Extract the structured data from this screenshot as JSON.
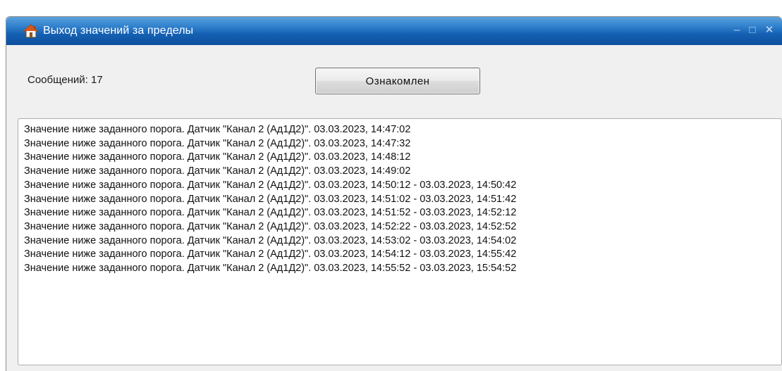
{
  "window": {
    "title": "Выход значений за пределы",
    "icon": "home-icon",
    "controls": {
      "minimize": "–",
      "maximize": "□",
      "close": "✕"
    },
    "colors": {
      "titlebar": "#1561b4",
      "background": "#f0f0f0"
    }
  },
  "header": {
    "count_label": "Сообщений: 17",
    "ack_button_label": "Ознакомлен"
  },
  "messages": [
    "Значение ниже заданного порога. Датчик \"Канал 2 (Ад1Д2)\". 03.03.2023, 14:47:02",
    "Значение ниже заданного порога. Датчик \"Канал 2 (Ад1Д2)\". 03.03.2023, 14:47:32",
    "Значение ниже заданного порога. Датчик \"Канал 2 (Ад1Д2)\". 03.03.2023, 14:48:12",
    "Значение ниже заданного порога. Датчик \"Канал 2 (Ад1Д2)\". 03.03.2023, 14:49:02",
    "Значение ниже заданного порога. Датчик \"Канал 2 (Ад1Д2)\". 03.03.2023, 14:50:12 - 03.03.2023, 14:50:42",
    "Значение ниже заданного порога. Датчик \"Канал 2 (Ад1Д2)\". 03.03.2023, 14:51:02 - 03.03.2023, 14:51:42",
    "Значение ниже заданного порога. Датчик \"Канал 2 (Ад1Д2)\". 03.03.2023, 14:51:52 - 03.03.2023, 14:52:12",
    "Значение ниже заданного порога. Датчик \"Канал 2 (Ад1Д2)\". 03.03.2023, 14:52:22 - 03.03.2023, 14:52:52",
    "Значение ниже заданного порога. Датчик \"Канал 2 (Ад1Д2)\". 03.03.2023, 14:53:02 - 03.03.2023, 14:54:02",
    "Значение ниже заданного порога. Датчик \"Канал 2 (Ад1Д2)\". 03.03.2023, 14:54:12 - 03.03.2023, 14:55:42",
    "Значение ниже заданного порога. Датчик \"Канал 2 (Ад1Д2)\". 03.03.2023, 14:55:52 - 03.03.2023, 15:54:52"
  ]
}
